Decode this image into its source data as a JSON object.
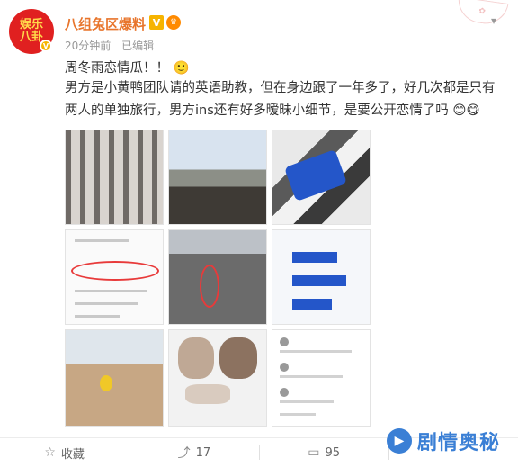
{
  "post": {
    "username": "八组兔区爆料",
    "avatar_text": [
      "娱乐",
      "八卦"
    ],
    "time": "20分钟前",
    "edited": "已编辑",
    "text_line1": "周冬雨恋情瓜！！",
    "text_line2": "男方是小黄鸭团队请的英语助教，但在身边跟了一年多了，好几次都是只有两人的单独旅行，男方ins还有好多暧昧小细节，是要公开恋情了吗"
  },
  "footer": {
    "favorite_label": "收藏",
    "repost_count": "17",
    "comment_count": "95"
  },
  "watermark": {
    "text": "剧情奥秘"
  },
  "icons": {
    "favorite": "star-icon",
    "repost": "repost-icon",
    "comment": "comment-icon",
    "more": "chevron-down-icon"
  },
  "colors": {
    "username": "#e8752c",
    "accent_blue": "#3a7fd5",
    "badge_gold": "#f6b400"
  }
}
